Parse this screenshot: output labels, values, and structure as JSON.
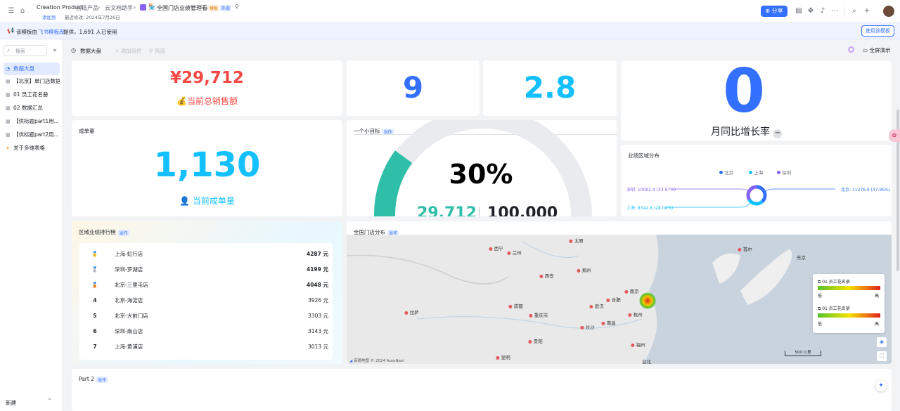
{
  "topbar": {
    "title_en": "Creation Product",
    "sep1": "创造产品",
    "sep2": "云文档助手",
    "doc_title": "全国门店业绩管理看板",
    "tag1": "模板",
    "tag2": "外部",
    "sub_left": "添加到",
    "sub_right": "最近修改: 2024年7月26日",
    "share": "分享"
  },
  "notice": {
    "prefix": "该模板由",
    "link": "飞书模板库",
    "suffix": "提供，1,691 人已使用",
    "btn": "使用该模板"
  },
  "sidebar": {
    "search_placeholder": "搜索",
    "items": [
      {
        "label": "数据大盘"
      },
      {
        "label": "【北京】单门店数据"
      },
      {
        "label": "01 员工花名册"
      },
      {
        "label": "02 数据汇总"
      },
      {
        "label": "【供标题part1用..."
      },
      {
        "label": "【供标题part2用..."
      },
      {
        "label": "关于多维表格"
      }
    ],
    "new": "新建"
  },
  "toolbar": {
    "title": "数据大盘",
    "add": "添加组件",
    "filter": "筛选",
    "fullscreen": "全屏演示"
  },
  "kpi": {
    "sales_value": "¥29,712",
    "sales_label": "当前总销售额",
    "v9": "9",
    "v28": "2.8",
    "v0": "0",
    "mom_label": "月同比增长率",
    "orders_title": "成单量",
    "orders_value": "1,130",
    "orders_label": "当前成单量"
  },
  "goal": {
    "title": "一个小目标",
    "tag": "当作",
    "pct": "30%",
    "left_val": "29,712",
    "right_val": "100,000"
  },
  "region": {
    "title": "业绩区域分布",
    "legend": [
      "北京",
      "上海",
      "深圳"
    ],
    "labels": {
      "shenzhen": "深圳: 10092.4 (33.97%)",
      "beijing": "北京: 11276.9 (37.95%)",
      "shanghai": "上海: 8342.8 (28.08%)"
    }
  },
  "rank": {
    "title": "区域业绩排行榜",
    "tag": "当作",
    "rows": [
      {
        "no": "1",
        "name": "上海-虹行店",
        "val": "4287 元"
      },
      {
        "no": "2",
        "name": "深圳-罗湖店",
        "val": "4199 元"
      },
      {
        "no": "3",
        "name": "北京-三里屯店",
        "val": "4048 元"
      },
      {
        "no": "4",
        "name": "北京-海淀店",
        "val": "3926 元"
      },
      {
        "no": "5",
        "name": "北京-大前门店",
        "val": "3303 元"
      },
      {
        "no": "6",
        "name": "深圳-南山店",
        "val": "3143 元"
      },
      {
        "no": "7",
        "name": "上海-黄浦店",
        "val": "3013 元"
      }
    ]
  },
  "map": {
    "title": "全国门店分布",
    "tag": "当作",
    "cities": [
      "西宁",
      "兰州",
      "太原",
      "郑州",
      "西安",
      "南京",
      "合肥",
      "武汉",
      "成都",
      "重庆市",
      "长沙",
      "南昌",
      "贵阳",
      "杭州",
      "福州",
      "昆明",
      "拉萨",
      "台北",
      "东京",
      "首尔"
    ],
    "layer1": "01 员工花名册",
    "layer2": "01 员工花名册",
    "low": "低",
    "high": "高",
    "scale": "500 公里",
    "copyright": "高德地图 © 2024 AutoNavi"
  },
  "part2": {
    "title": "Part 2",
    "tag": "当作"
  }
}
